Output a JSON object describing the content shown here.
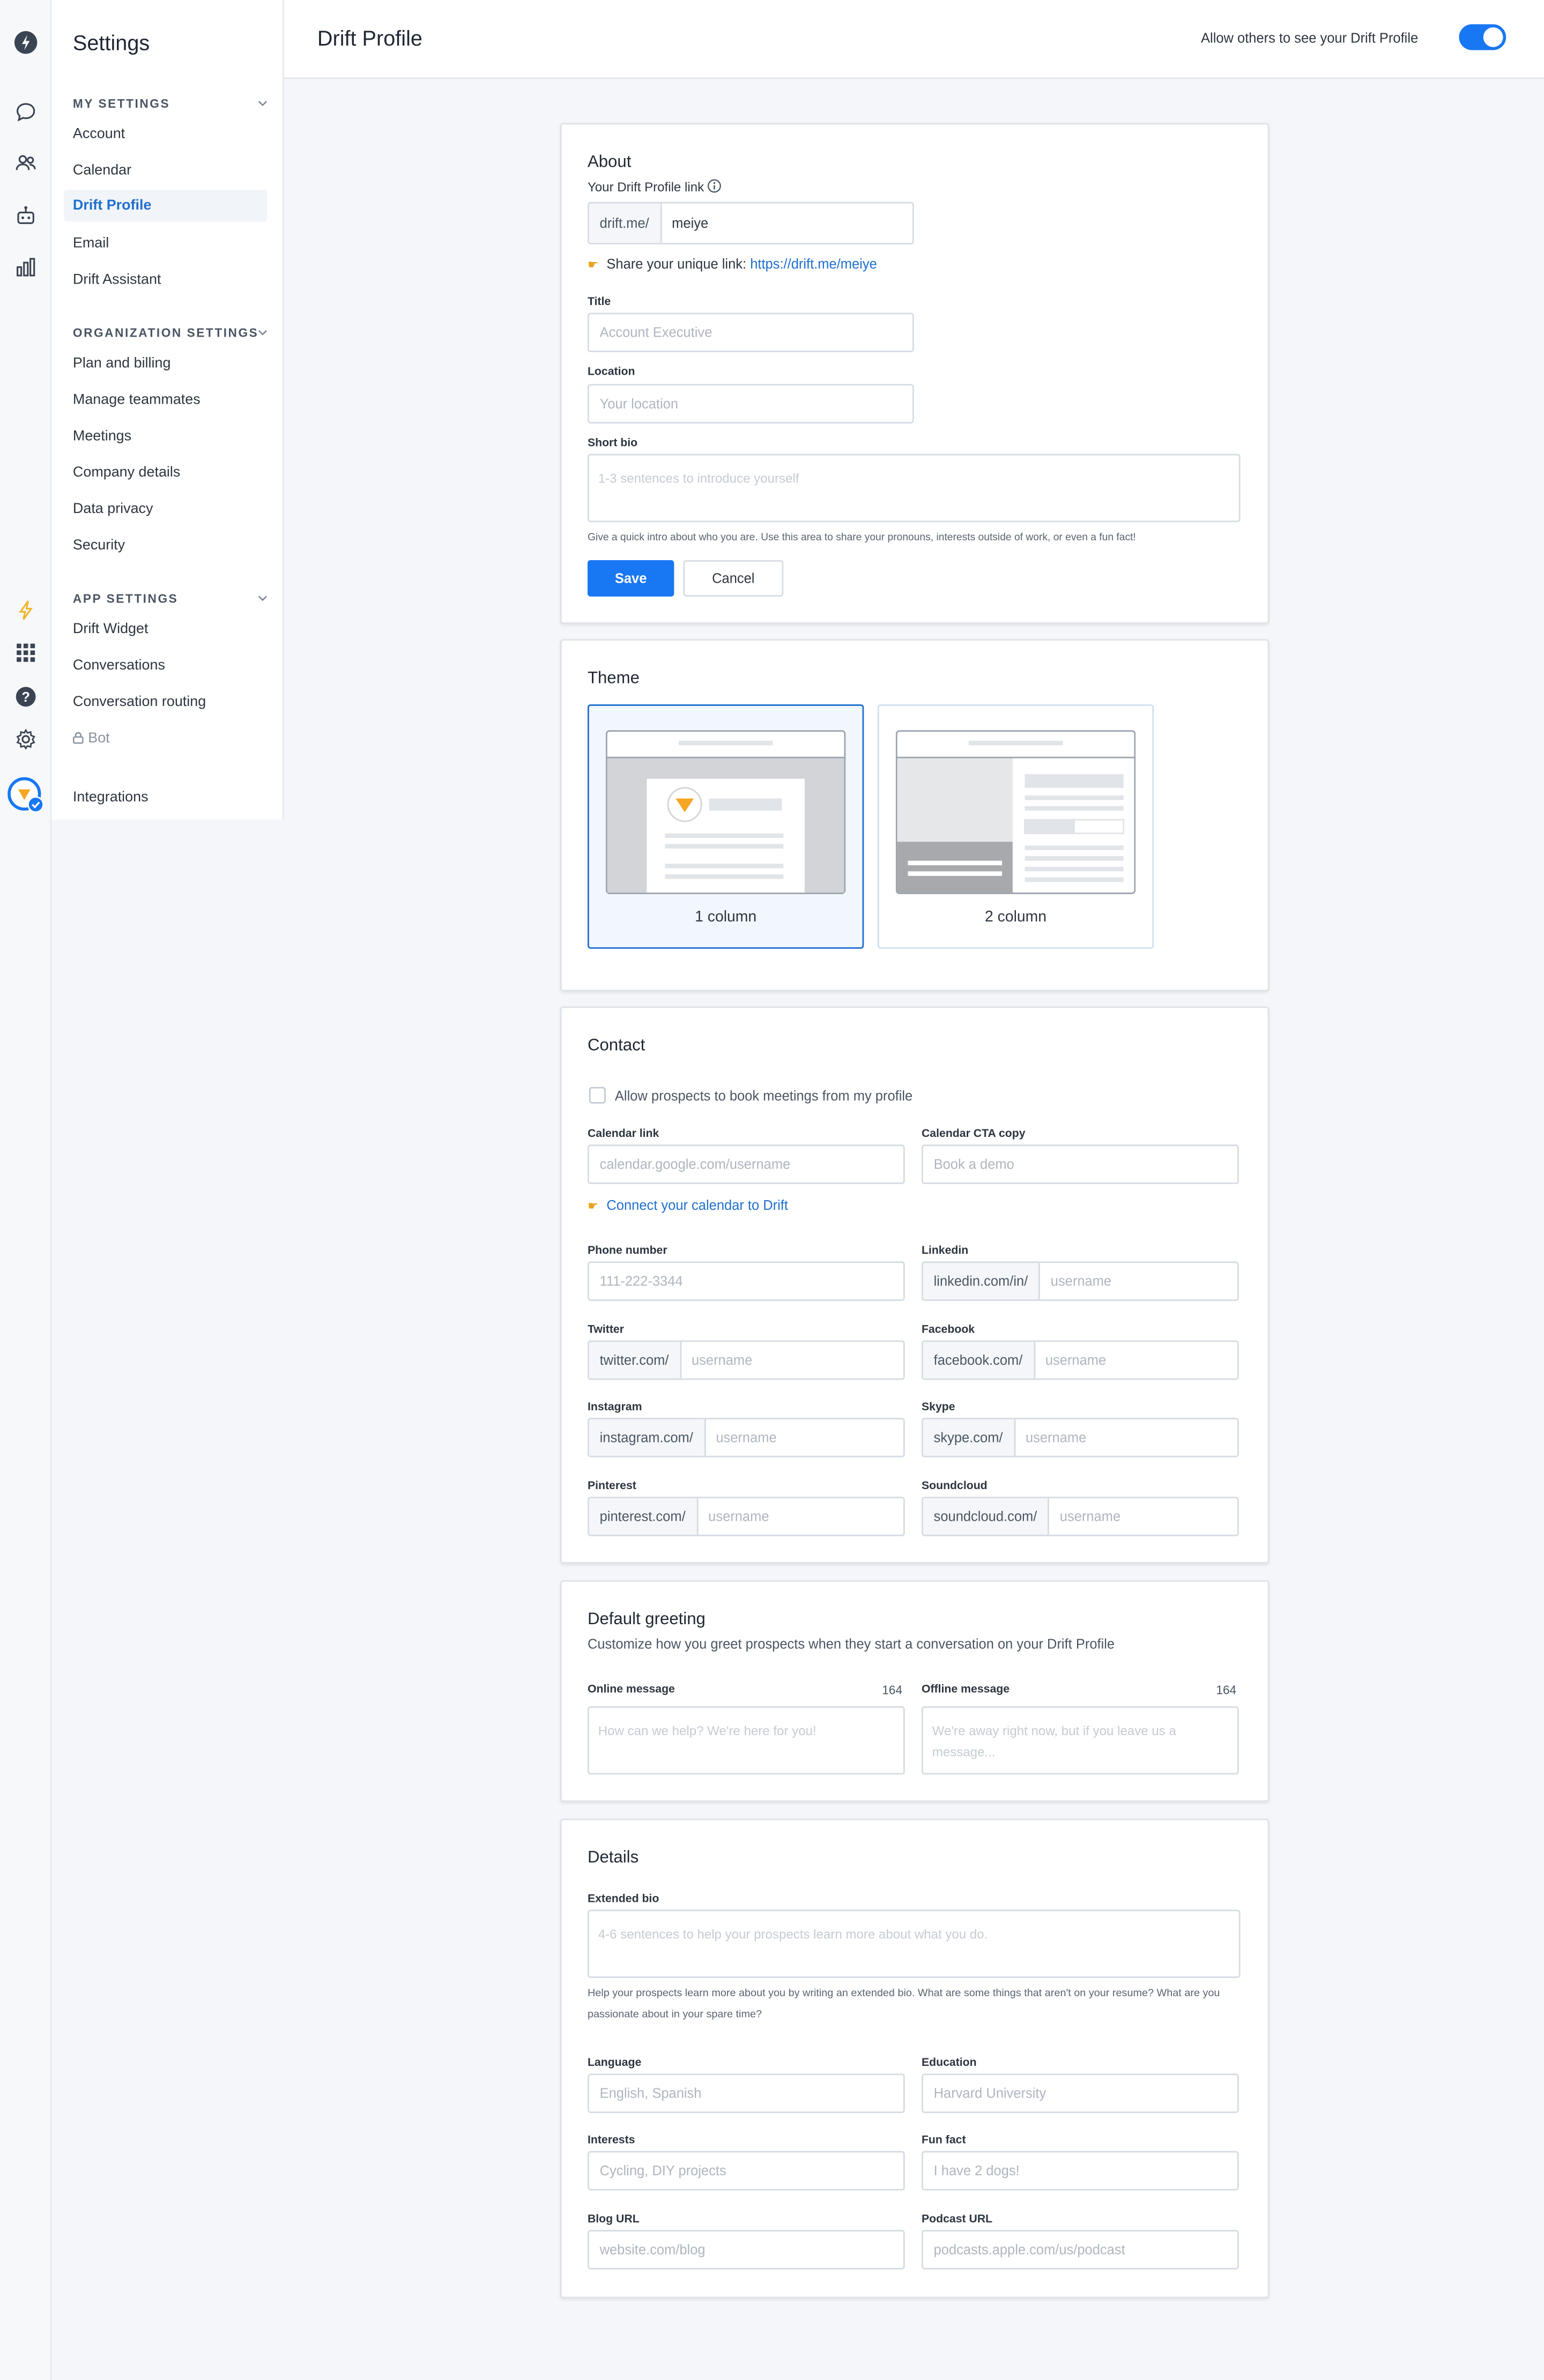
{
  "app": {
    "settings_title": "Settings",
    "page_title": "Drift Profile",
    "visibility_label": "Allow others to see your Drift Profile",
    "visibility_on": true,
    "accent_color": "#1877f2"
  },
  "rail": {
    "icons": [
      "drift-logo-icon",
      "chat-bubble-icon",
      "contacts-icon",
      "bot-icon",
      "reports-icon",
      "lightning-icon",
      "apps-grid-icon",
      "help-icon",
      "gear-icon",
      "user-avatar-icon"
    ]
  },
  "sidebar": {
    "my_settings": {
      "heading": "MY SETTINGS",
      "items": [
        "Account",
        "Calendar",
        "Drift Profile",
        "Email",
        "Drift Assistant"
      ]
    },
    "org_settings": {
      "heading": "ORGANIZATION SETTINGS",
      "items": [
        "Plan and billing",
        "Manage teammates",
        "Meetings",
        "Company details",
        "Data privacy",
        "Security"
      ]
    },
    "app_settings": {
      "heading": "APP SETTINGS",
      "items": [
        "Drift Widget",
        "Conversations",
        "Conversation routing",
        "Bot"
      ]
    },
    "integrations": "Integrations"
  },
  "about": {
    "heading": "About",
    "profile_link_label": "Your Drift Profile link",
    "profile_prefix": "drift.me/",
    "profile_value": "meiye",
    "share_text": "Share your unique link:",
    "share_link": "https://drift.me/meiye",
    "title_label": "Title",
    "title_placeholder": "Account Executive",
    "location_label": "Location",
    "location_placeholder": "Your location",
    "bio_label": "Short bio",
    "bio_placeholder": "1-3 sentences to introduce yourself",
    "bio_help": "Give a quick intro about who you are. Use this area to share your pronouns, interests outside of work, or even a fun fact!",
    "save": "Save",
    "cancel": "Cancel"
  },
  "theme": {
    "heading": "Theme",
    "options": [
      "1 column",
      "2 column"
    ],
    "selected": "1 column"
  },
  "contact": {
    "heading": "Contact",
    "allow_booking": "Allow prospects to book meetings from my profile",
    "calendar_link_label": "Calendar link",
    "calendar_link_placeholder": "calendar.google.com/username",
    "calendar_cta_label": "Calendar CTA copy",
    "calendar_cta_placeholder": "Book a demo",
    "connect_calendar": "Connect your calendar to Drift",
    "phone_label": "Phone number",
    "phone_placeholder": "111-222-3344",
    "fields": [
      {
        "label": "Linkedin",
        "prefix": "linkedin.com/in/",
        "placeholder": "username"
      },
      {
        "label": "Twitter",
        "prefix": "twitter.com/",
        "placeholder": "username"
      },
      {
        "label": "Facebook",
        "prefix": "facebook.com/",
        "placeholder": "username"
      },
      {
        "label": "Instagram",
        "prefix": "instagram.com/",
        "placeholder": "username"
      },
      {
        "label": "Skype",
        "prefix": "skype.com/",
        "placeholder": "username"
      },
      {
        "label": "Pinterest",
        "prefix": "pinterest.com/",
        "placeholder": "username"
      },
      {
        "label": "Soundcloud",
        "prefix": "soundcloud.com/",
        "placeholder": "username"
      }
    ]
  },
  "greeting": {
    "heading": "Default greeting",
    "subtitle": "Customize how you greet prospects when they start a conversation on your Drift Profile",
    "online_label": "Online message",
    "online_count": "164",
    "online_placeholder": "How can we help? We're here for you!",
    "offline_label": "Offline message",
    "offline_count": "164",
    "offline_placeholder": "We're away right now, but if you leave us a message..."
  },
  "details": {
    "heading": "Details",
    "extended_bio_label": "Extended bio",
    "extended_bio_placeholder": "4-6 sentences to help your prospects learn more about what you do.",
    "extended_bio_help": "Help your prospects learn more about you by writing an extended bio. What are some things that aren't on your resume? What are you passionate about in your spare time?",
    "language_label": "Language",
    "language_placeholder": "English, Spanish",
    "education_label": "Education",
    "education_placeholder": "Harvard University",
    "interests_label": "Interests",
    "interests_placeholder": "Cycling, DIY projects",
    "funfact_label": "Fun fact",
    "funfact_placeholder": "I have 2 dogs!",
    "blog_label": "Blog URL",
    "blog_placeholder": "website.com/blog",
    "podcast_label": "Podcast URL",
    "podcast_placeholder": "podcasts.apple.com/us/podcast"
  }
}
